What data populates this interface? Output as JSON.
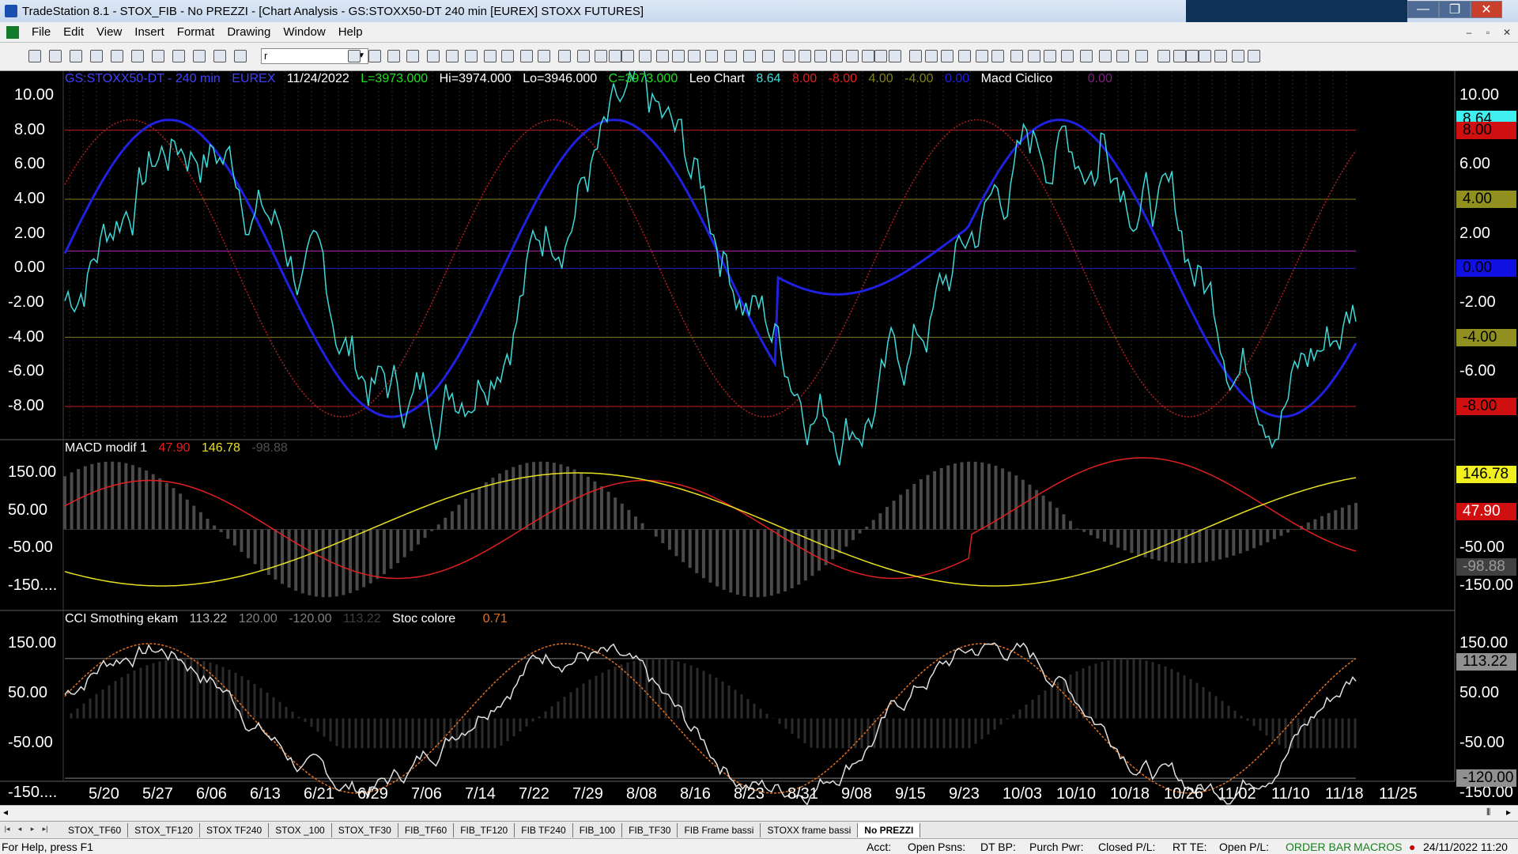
{
  "window": {
    "title": "TradeStation 8.1 - STOX_FIB - No PREZZI - [Chart Analysis - GS:STOXX50-DT  240 min  [EUREX] STOXX FUTURES]"
  },
  "menu": [
    "File",
    "Edit",
    "View",
    "Insert",
    "Format",
    "Drawing",
    "Window",
    "Help"
  ],
  "toolbar": {
    "symbol_value": "r"
  },
  "pane1": {
    "symbol": "GS:STOXX50-DT - 240 min",
    "exchange": "EUREX",
    "date": "11/24/2022",
    "low": "L=3973.000",
    "high": "Hi=3974.000",
    "lo": "Lo=3946.000",
    "close": "C=3973.000",
    "indicator": "Leo Chart",
    "v1": "8.64",
    "v2": "8.00",
    "v3": "-8.00",
    "v4": "4.00",
    "v5": "-4.00",
    "v6": "0.00",
    "indicator2": "Macd Ciclico",
    "v7": "0.00",
    "yticks": [
      "10.00",
      "8.00",
      "6.00",
      "4.00",
      "2.00",
      "0.00",
      "-2.00",
      "-4.00",
      "-6.00",
      "-8.00"
    ],
    "right_ticks": [
      "10.00",
      "6.00",
      "2.00",
      "-2.00",
      "-6.00"
    ],
    "badges": [
      "8.64",
      "8.00",
      "4.00",
      "0.00",
      "-4.00",
      "-8.00"
    ]
  },
  "pane2": {
    "indicator": "MACD modif 1",
    "v1": "47.90",
    "v2": "146.78",
    "v3": "-98.88",
    "yticks": [
      "150.00",
      "50.00",
      "-50.00",
      "-150...."
    ],
    "right_ticks": [
      "150.00",
      "50.00",
      "-50.00",
      "-150.00"
    ],
    "badges": [
      "146.78",
      "47.90",
      "-98.88"
    ]
  },
  "pane3": {
    "indicator": "CCI Smothing ekam",
    "v1": "113.22",
    "v2": "120.00",
    "v3": "-120.00",
    "v4": "113.22",
    "indicator2": "Stoc colore",
    "v5": "0.71",
    "yticks": [
      "150.00",
      "50.00",
      "-50.00",
      "-150...."
    ],
    "right_ticks": [
      "150.00",
      "50.00",
      "-50.00",
      "-150.00"
    ],
    "badges": [
      "113.22",
      "-120.00"
    ]
  },
  "dates": [
    "5/20",
    "5/27",
    "6/06",
    "6/13",
    "6/21",
    "6/29",
    "7/06",
    "7/14",
    "7/22",
    "7/29",
    "8/08",
    "8/16",
    "8/23",
    "8/31",
    "9/08",
    "9/15",
    "9/23",
    "10/03",
    "10/10",
    "10/18",
    "10/26",
    "11/02",
    "11/10",
    "11/18",
    "11/25"
  ],
  "tabs": [
    "STOX_TF60",
    "STOX_TF120",
    "STOX TF240",
    "STOX _100",
    "STOX_TF30",
    "FIB_TF60",
    "FIB_TF120",
    "FIB TF240",
    "FIB_100",
    "FIB_TF30",
    "FIB Frame bassi",
    "STOXX frame bassi",
    "No PREZZI"
  ],
  "status": {
    "help": "For Help, press F1",
    "acct": "Acct:",
    "open_psns": "Open Psns:",
    "dt_bp": "DT BP:",
    "purch_pwr": "Purch Pwr:",
    "closed_pl": "Closed P/L:",
    "rt_te": "RT TE:",
    "open_pl": "Open P/L:",
    "order_bar": "ORDER BAR",
    "macros": "MACROS",
    "datetime": "24/11/2022 11:20"
  },
  "colors": {
    "blue_line": "#2020e0",
    "cyan_line": "#40d8d8",
    "red_dotted": "#b02020",
    "macd_red": "#e02020",
    "macd_yellow": "#e8e020",
    "cci_white": "#e0e0e0",
    "stoc_orange": "#e07020"
  }
}
